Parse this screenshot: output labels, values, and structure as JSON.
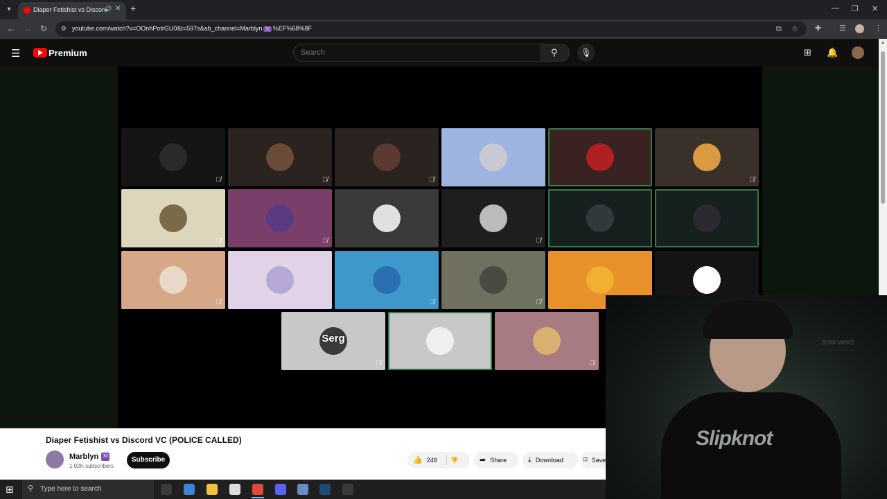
{
  "browser": {
    "tab_title": "Diaper Fetishist vs Discord",
    "url": "youtube.com/watch?v=OOnhPotrGU0&t=597s&ab_channel=Marblyn",
    "url_badge": "ℳ",
    "url_suffix": "%EF%68%8F",
    "icons": {
      "tab_list": "chevron-down-icon",
      "audio": "speaker-icon",
      "close": "close-icon",
      "new_tab": "plus-icon",
      "back": "arrow-left-icon",
      "forward": "arrow-right-icon",
      "reload": "reload-icon"
    }
  },
  "youtube": {
    "brand": "Premium",
    "search_placeholder": "Search"
  },
  "video": {
    "tile_label": "Serg",
    "tiles": [
      {
        "bg": "#151515",
        "avatar": "#2a2a2a",
        "muted": true,
        "speaking": false
      },
      {
        "bg": "#2a2320",
        "avatar": "#6b4a38",
        "muted": true,
        "speaking": false
      },
      {
        "bg": "#2a2320",
        "avatar": "#5a3a30",
        "muted": true,
        "speaking": false
      },
      {
        "bg": "#9db4e0",
        "avatar": "#c9c9d6",
        "muted": false,
        "speaking": false
      },
      {
        "bg": "#3a2222",
        "avatar": "#b02020",
        "muted": false,
        "speaking": true
      },
      {
        "bg": "#3a302a",
        "avatar": "#d99a40",
        "muted": true,
        "speaking": false
      },
      {
        "bg": "#ddd5bc",
        "avatar": "#7a6a4a",
        "muted": true,
        "speaking": false
      },
      {
        "bg": "#7a3e6a",
        "avatar": "#5a3a80",
        "muted": true,
        "speaking": false
      },
      {
        "bg": "#3a3a38",
        "avatar": "#e0e0e0",
        "muted": false,
        "speaking": false
      },
      {
        "bg": "#1e1e1e",
        "avatar": "#bbbbbb",
        "muted": true,
        "speaking": false
      },
      {
        "bg": "#16201f",
        "avatar": "#303a3a",
        "muted": false,
        "speaking": true
      },
      {
        "bg": "#16201f",
        "avatar": "#2a2a30",
        "muted": false,
        "speaking": true
      },
      {
        "bg": "#d6a888",
        "avatar": "#e8d8c8",
        "muted": true,
        "speaking": false
      },
      {
        "bg": "#e2d2e8",
        "avatar": "#b8a8d8",
        "muted": false,
        "speaking": false
      },
      {
        "bg": "#3e98cc",
        "avatar": "#2a70b0",
        "muted": true,
        "speaking": false
      },
      {
        "bg": "#707060",
        "avatar": "#4a4a40",
        "muted": true,
        "speaking": false
      },
      {
        "bg": "#e8902a",
        "avatar": "#f0b030",
        "muted": false,
        "speaking": false
      },
      {
        "bg": "#141414",
        "avatar": "#ffffff",
        "muted": false,
        "speaking": false
      },
      {
        "bg": "#c8c8c8",
        "avatar": "#3a3a3a",
        "muted": true,
        "speaking": false,
        "label": true
      },
      {
        "bg": "#c8c8c8",
        "avatar": "#f0f0f0",
        "muted": false,
        "speaking": true
      },
      {
        "bg": "#a87a82",
        "avatar": "#d8b070",
        "muted": true,
        "speaking": false
      }
    ]
  },
  "webcam": {
    "shirt_text": "Slipknot",
    "wall_text": "STAR WARS"
  },
  "info": {
    "title": "Diaper Fetishist vs Discord VC (POLICE CALLED)",
    "channel_name": "Marblyn",
    "channel_badge": "ℳ",
    "subscribers": "1.02K subscribers",
    "subscribe": "Subscribe",
    "likes": "248",
    "share": "Share",
    "download": "Download",
    "save": "Save"
  },
  "taskbar": {
    "search_text": "Type here to search",
    "apps": [
      {
        "name": "task-view",
        "color": "#3a3a3a"
      },
      {
        "name": "copilot",
        "color": "#3b82d9"
      },
      {
        "name": "file-explorer",
        "color": "#f0c040"
      },
      {
        "name": "store",
        "color": "#dddddd"
      },
      {
        "name": "chrome",
        "color": "#e04a3a"
      },
      {
        "name": "discord",
        "color": "#5865f2"
      },
      {
        "name": "app-window",
        "color": "#6a8ac8"
      },
      {
        "name": "steam",
        "color": "#1b4a74"
      },
      {
        "name": "obs",
        "color": "#3a3a3a"
      }
    ]
  }
}
